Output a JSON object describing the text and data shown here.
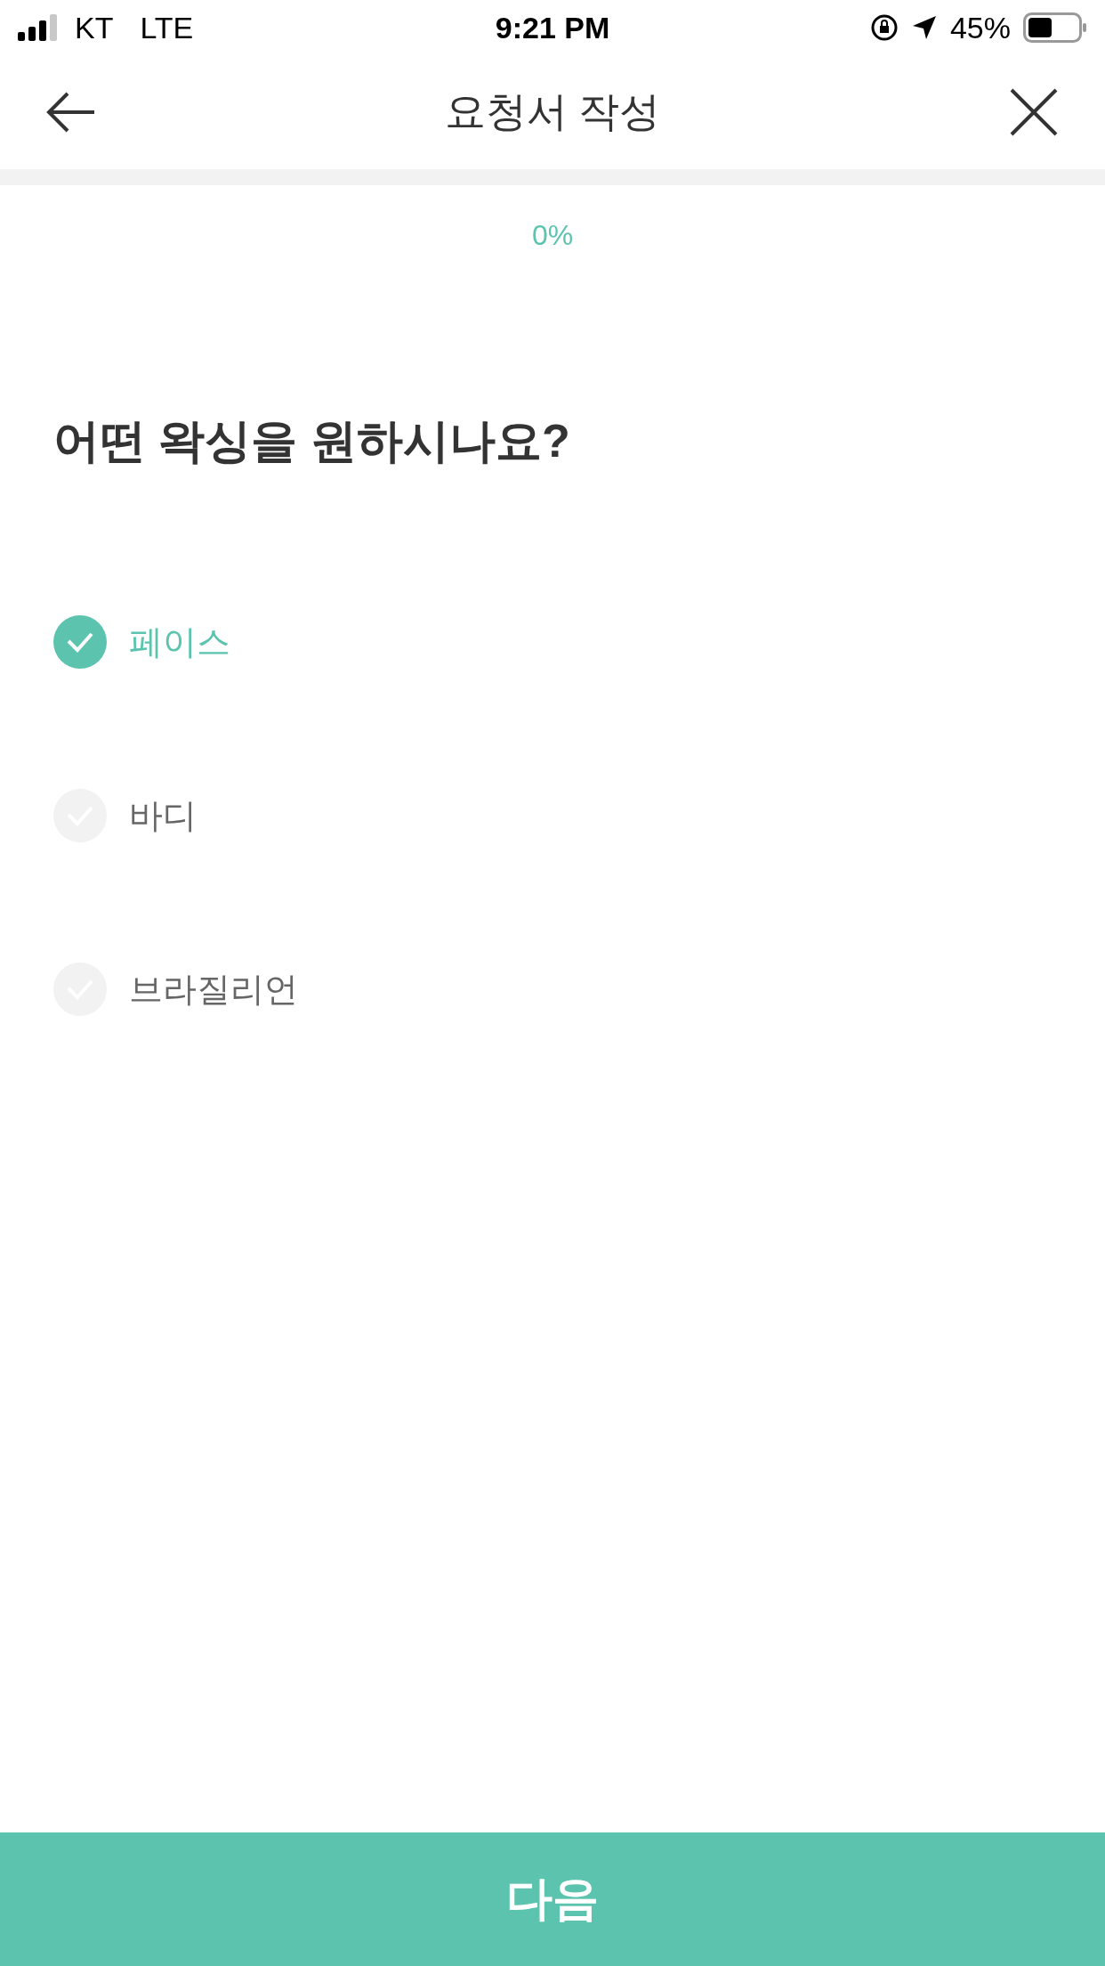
{
  "status_bar": {
    "carrier": "KT",
    "network": "LTE",
    "time": "9:21 PM",
    "battery": "45%"
  },
  "header": {
    "title": "요청서 작성"
  },
  "progress": {
    "level": 0,
    "reading": "0%"
  },
  "question": "어떤 왁싱을 원하시나요?",
  "options": [
    {
      "label": "페이스",
      "selected": true
    },
    {
      "label": "바디",
      "selected": false
    },
    {
      "label": "브라질리언",
      "selected": false
    }
  ],
  "next_button": "다음"
}
